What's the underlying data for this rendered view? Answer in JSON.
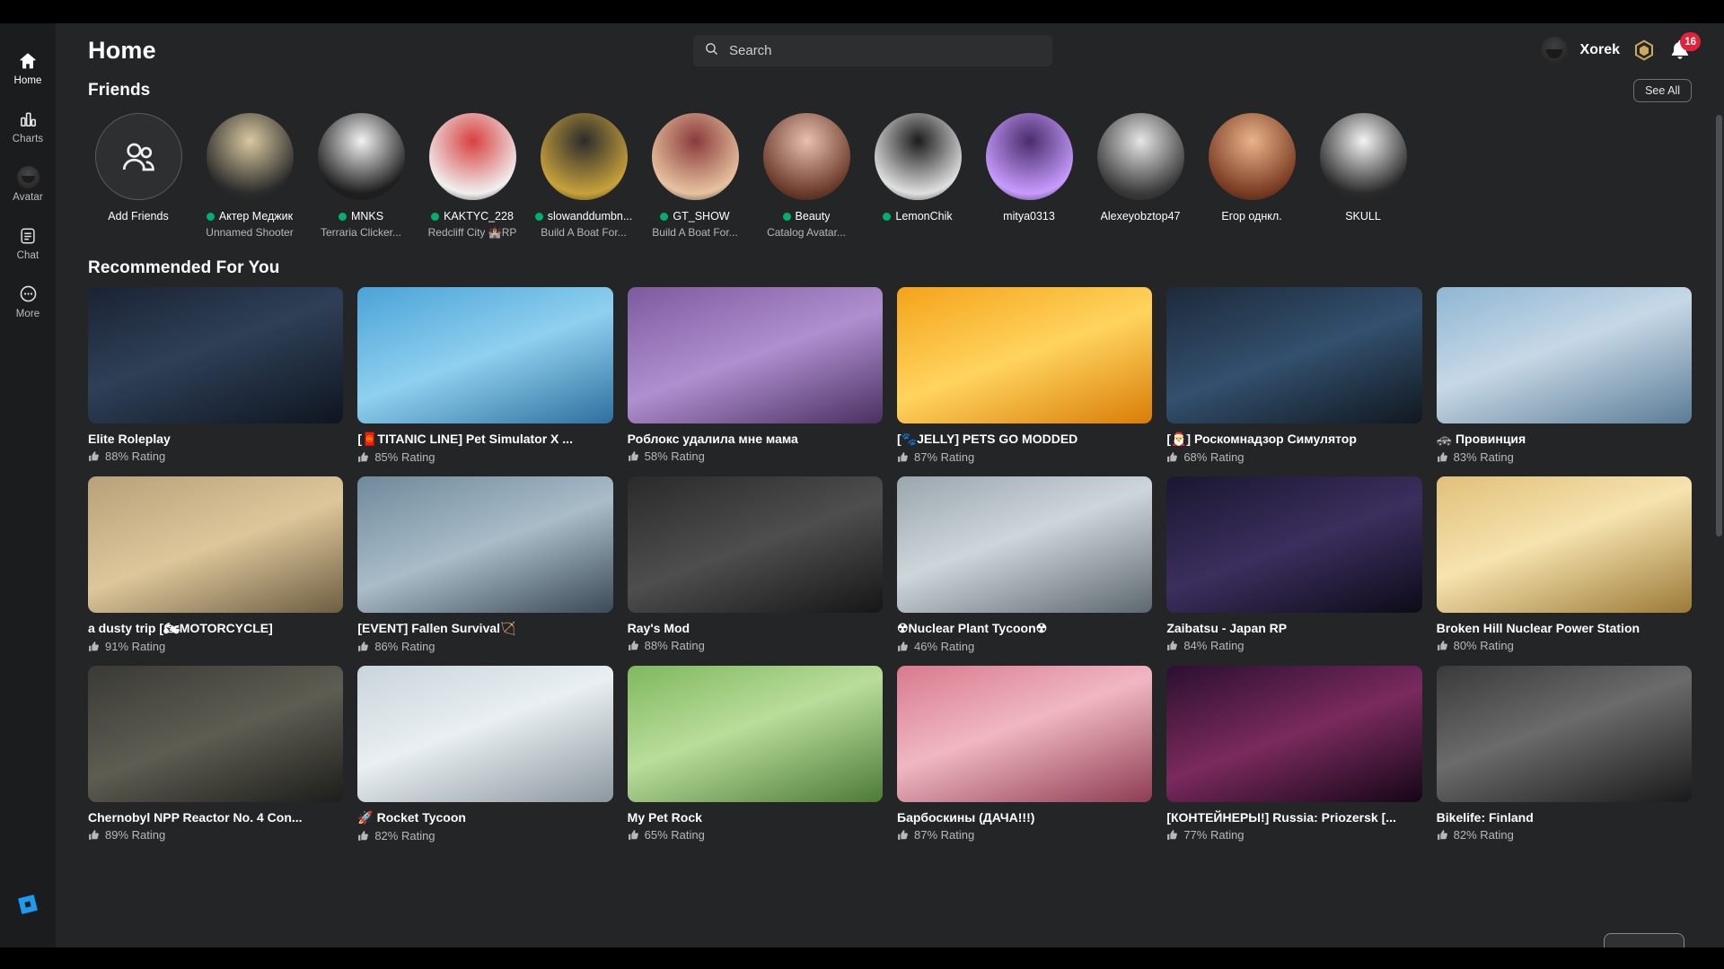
{
  "window": {
    "title": "Home"
  },
  "sidebar": {
    "items": [
      {
        "label": "Home",
        "icon": "home-icon",
        "active": true
      },
      {
        "label": "Charts",
        "icon": "charts-icon",
        "active": false
      },
      {
        "label": "Avatar",
        "icon": "avatar-icon",
        "active": false
      },
      {
        "label": "Chat",
        "icon": "chat-icon",
        "active": false
      },
      {
        "label": "More",
        "icon": "more-icon",
        "active": false
      }
    ],
    "taskbar_icon": "roblox-studio-icon"
  },
  "header": {
    "title": "Home",
    "search_placeholder": "Search",
    "search_value": "",
    "search_icon": "search-icon",
    "user_name": "Xorek",
    "robux_icon": "robux-icon",
    "bell_icon": "bell-icon",
    "notification_count": "16"
  },
  "friends_section": {
    "title": "Friends",
    "see_all_label": "See All",
    "add_friends_label": "Add Friends",
    "items": [
      {
        "name": "Актер Меджик",
        "game": "Unnamed Shooter",
        "online": true
      },
      {
        "name": "MNKS",
        "game": "Terraria Clicker...",
        "online": true
      },
      {
        "name": "KAKTYC_228",
        "game": "Redcliff City 🏰RP",
        "online": true
      },
      {
        "name": "slowanddumbn...",
        "game": "Build A Boat For...",
        "online": true
      },
      {
        "name": "GT_SHOW",
        "game": "Build A Boat For...",
        "online": true
      },
      {
        "name": "Beauty",
        "game": "Catalog Avatar...",
        "online": true
      },
      {
        "name": "LemonChik",
        "game": "",
        "online": true
      },
      {
        "name": "mitya0313",
        "game": "",
        "online": false
      },
      {
        "name": "Alexeyobztop47",
        "game": "",
        "online": false
      },
      {
        "name": "Егор однкл.",
        "game": "",
        "online": false
      },
      {
        "name": "SKULL",
        "game": "",
        "online": false
      }
    ]
  },
  "recommended_section": {
    "title": "Recommended For You",
    "rating_suffix": "Rating",
    "games": [
      {
        "title": "Elite Roleplay",
        "rating": "88% Rating"
      },
      {
        "title": "[🧧TITANIC LINE] Pet Simulator X ...",
        "rating": "85% Rating"
      },
      {
        "title": "Роблокс удалила мне мама",
        "rating": "58% Rating"
      },
      {
        "title": "[🐾JELLY] PETS GO MODDED",
        "rating": "87% Rating"
      },
      {
        "title": "[🎅] Роскомнадзор Симулятор",
        "rating": "68% Rating"
      },
      {
        "title": "🚓 Провинция",
        "rating": "83% Rating"
      },
      {
        "title": "a dusty trip [🏍MOTORCYCLE]",
        "rating": "91% Rating"
      },
      {
        "title": "[EVENT] Fallen Survival🏹",
        "rating": "86% Rating"
      },
      {
        "title": "Ray's Mod",
        "rating": "88% Rating"
      },
      {
        "title": "☢Nuclear Plant Tycoon☢",
        "rating": "46% Rating"
      },
      {
        "title": "Zaibatsu - Japan RP",
        "rating": "84% Rating"
      },
      {
        "title": "Broken Hill Nuclear Power Station",
        "rating": "80% Rating"
      },
      {
        "title": "Chernobyl NPP Reactor No. 4 Con...",
        "rating": "89% Rating"
      },
      {
        "title": "🚀 Rocket Tycoon",
        "rating": "82% Rating"
      },
      {
        "title": "My Pet Rock",
        "rating": "65% Rating"
      },
      {
        "title": "Барбоскины (ДАЧА!!!)",
        "rating": "87% Rating"
      },
      {
        "title": "[КОНТЕЙНЕРЫ!] Russia: Priozersk [...",
        "rating": "77% Rating"
      },
      {
        "title": "Bikelife: Finland",
        "rating": "82% Rating"
      }
    ]
  },
  "colors": {
    "app_bg": "#232527",
    "rail_bg": "#1b1c1e",
    "online_green": "#00b06f",
    "badge_red": "#e2223b",
    "robux_gold": "#c9aa5f"
  }
}
